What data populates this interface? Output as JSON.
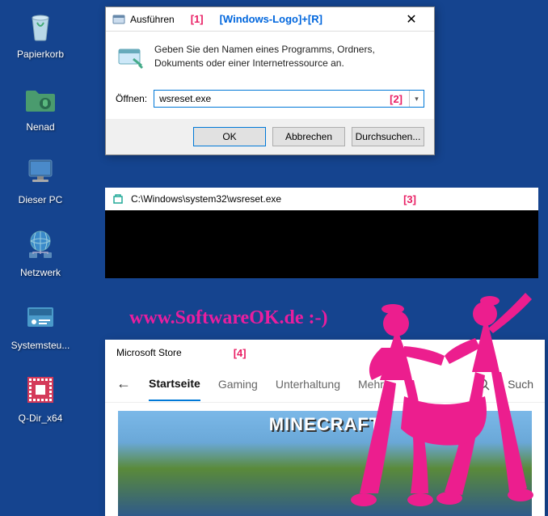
{
  "desktop": {
    "icons": [
      {
        "name": "recycle-bin",
        "label": "Papierkorb"
      },
      {
        "name": "folder-nenad",
        "label": "Nenad"
      },
      {
        "name": "this-pc",
        "label": "Dieser PC"
      },
      {
        "name": "network",
        "label": "Netzwerk"
      },
      {
        "name": "control-panel",
        "label": "Systemsteu..."
      },
      {
        "name": "qdir",
        "label": "Q-Dir_x64"
      }
    ]
  },
  "run": {
    "title": "Ausführen",
    "annotation1": "[1]",
    "hint": "[Windows-Logo]+[R]",
    "description": "Geben Sie den Namen eines Programms, Ordners, Dokuments oder einer Internetressource an.",
    "open_label": "Öffnen:",
    "value": "wsreset.exe",
    "annotation2": "[2]",
    "ok": "OK",
    "cancel": "Abbrechen",
    "browse": "Durchsuchen..."
  },
  "console": {
    "path": "C:\\Windows\\system32\\wsreset.exe",
    "annotation3": "[3]"
  },
  "watermark": "www.SoftwareOK.de :-)",
  "store": {
    "title": "Microsoft Store",
    "annotation4": "[4]",
    "tabs": {
      "home": "Startseite",
      "gaming": "Gaming",
      "entertainment": "Unterhaltung",
      "more": "Mehr"
    },
    "search": "Such",
    "hero_logo": "MINECRAFT"
  }
}
